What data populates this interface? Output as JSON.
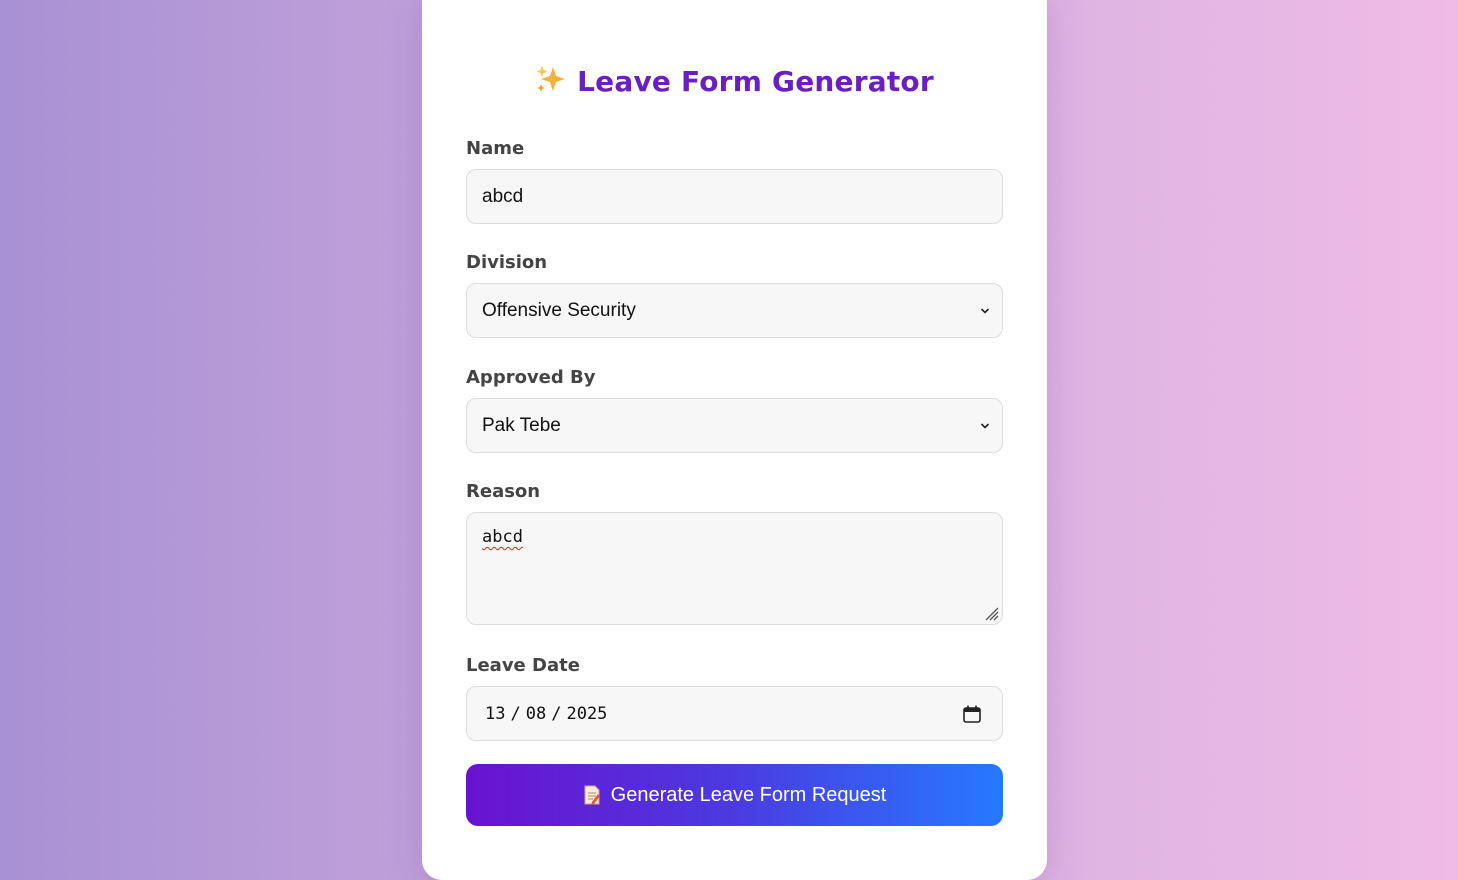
{
  "page": {
    "title": "Leave Form Generator",
    "title_icon": "sparkles-icon"
  },
  "form": {
    "name": {
      "label": "Name",
      "value": "abcd"
    },
    "division": {
      "label": "Division",
      "value": "Offensive Security"
    },
    "approved_by": {
      "label": "Approved By",
      "value": "Pak Tebe"
    },
    "reason": {
      "label": "Reason",
      "value": "abcd"
    },
    "leave_date": {
      "label": "Leave Date",
      "day": "13",
      "month": "08",
      "year": "2025",
      "separator": "/"
    }
  },
  "submit": {
    "label": "Generate Leave Form Request",
    "icon": "memo-icon"
  },
  "colors": {
    "title": "#6a1fc2",
    "button_gradient_start": "#6a12cf",
    "button_gradient_end": "#2779ff",
    "field_background": "#f7f7f7"
  }
}
